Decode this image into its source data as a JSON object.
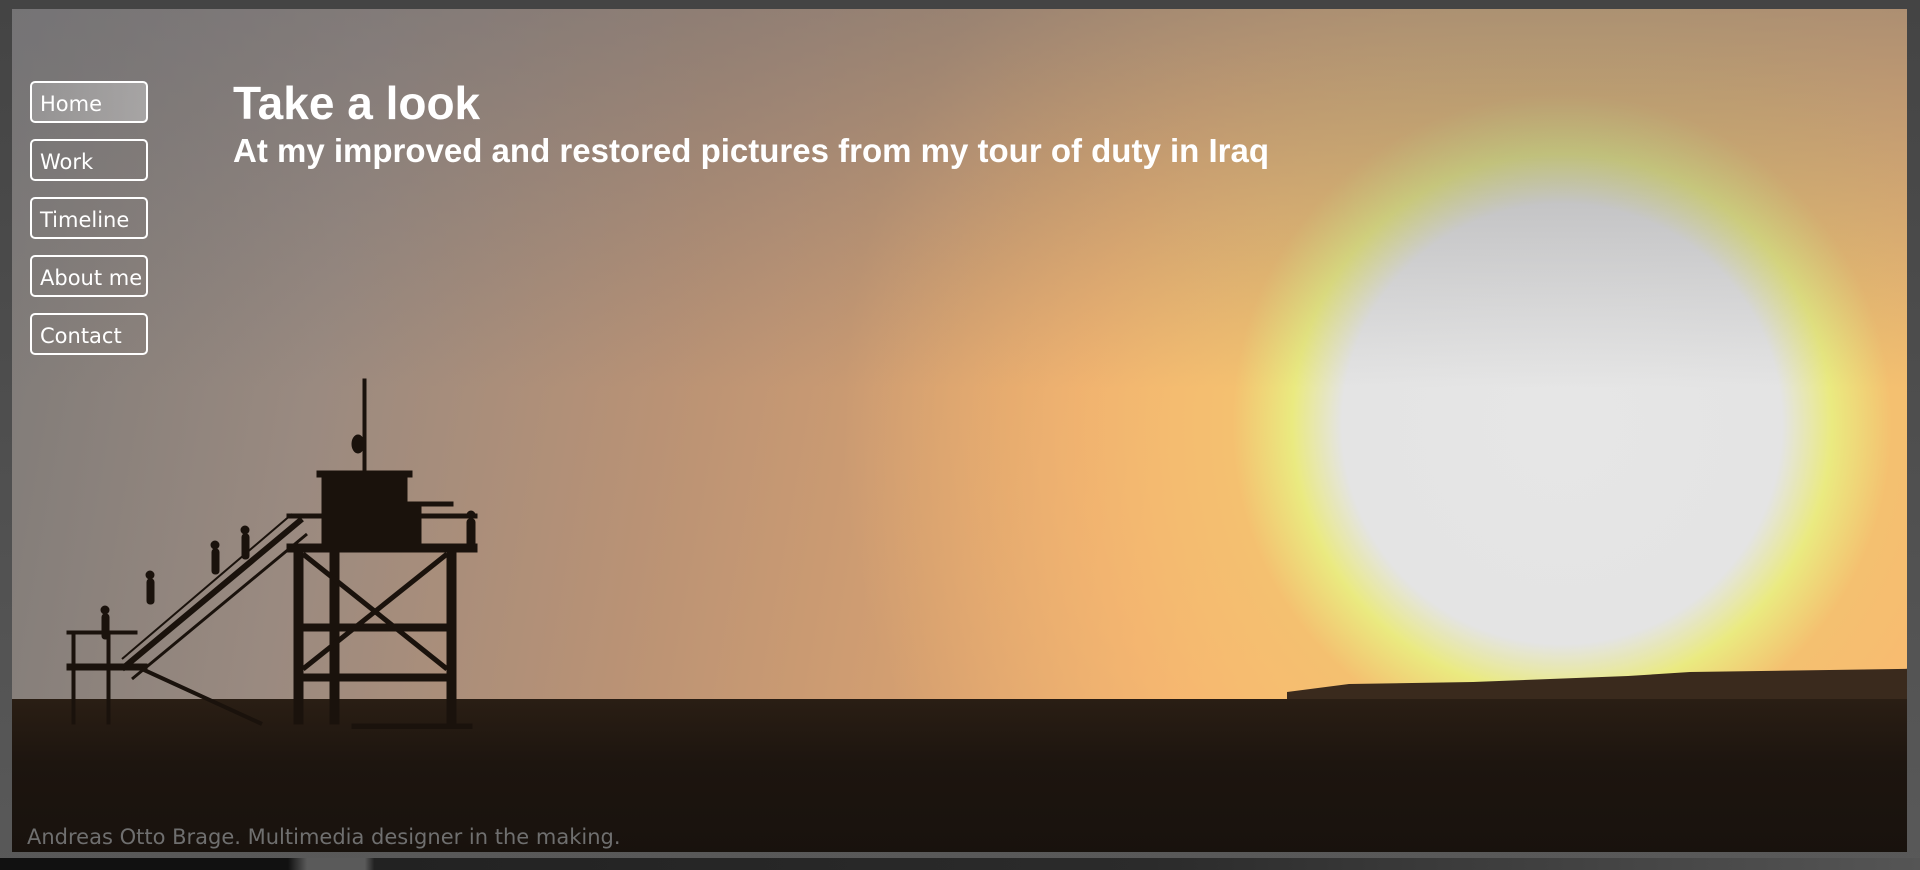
{
  "nav": {
    "items": [
      {
        "label": "Home",
        "active": true
      },
      {
        "label": "Work"
      },
      {
        "label": "Timeline"
      },
      {
        "label": "About me"
      },
      {
        "label": "Contact"
      }
    ]
  },
  "hero": {
    "title": "Take a look",
    "subtitle": "At my improved and restored pictures from my tour of duty in Iraq"
  },
  "footer": {
    "text": "Andreas Otto Brage. Multimedia designer in the making."
  },
  "colors": {
    "nav_border": "#ffffff",
    "heading_text": "#ffffff",
    "footer_text": "#6f6f6f"
  }
}
